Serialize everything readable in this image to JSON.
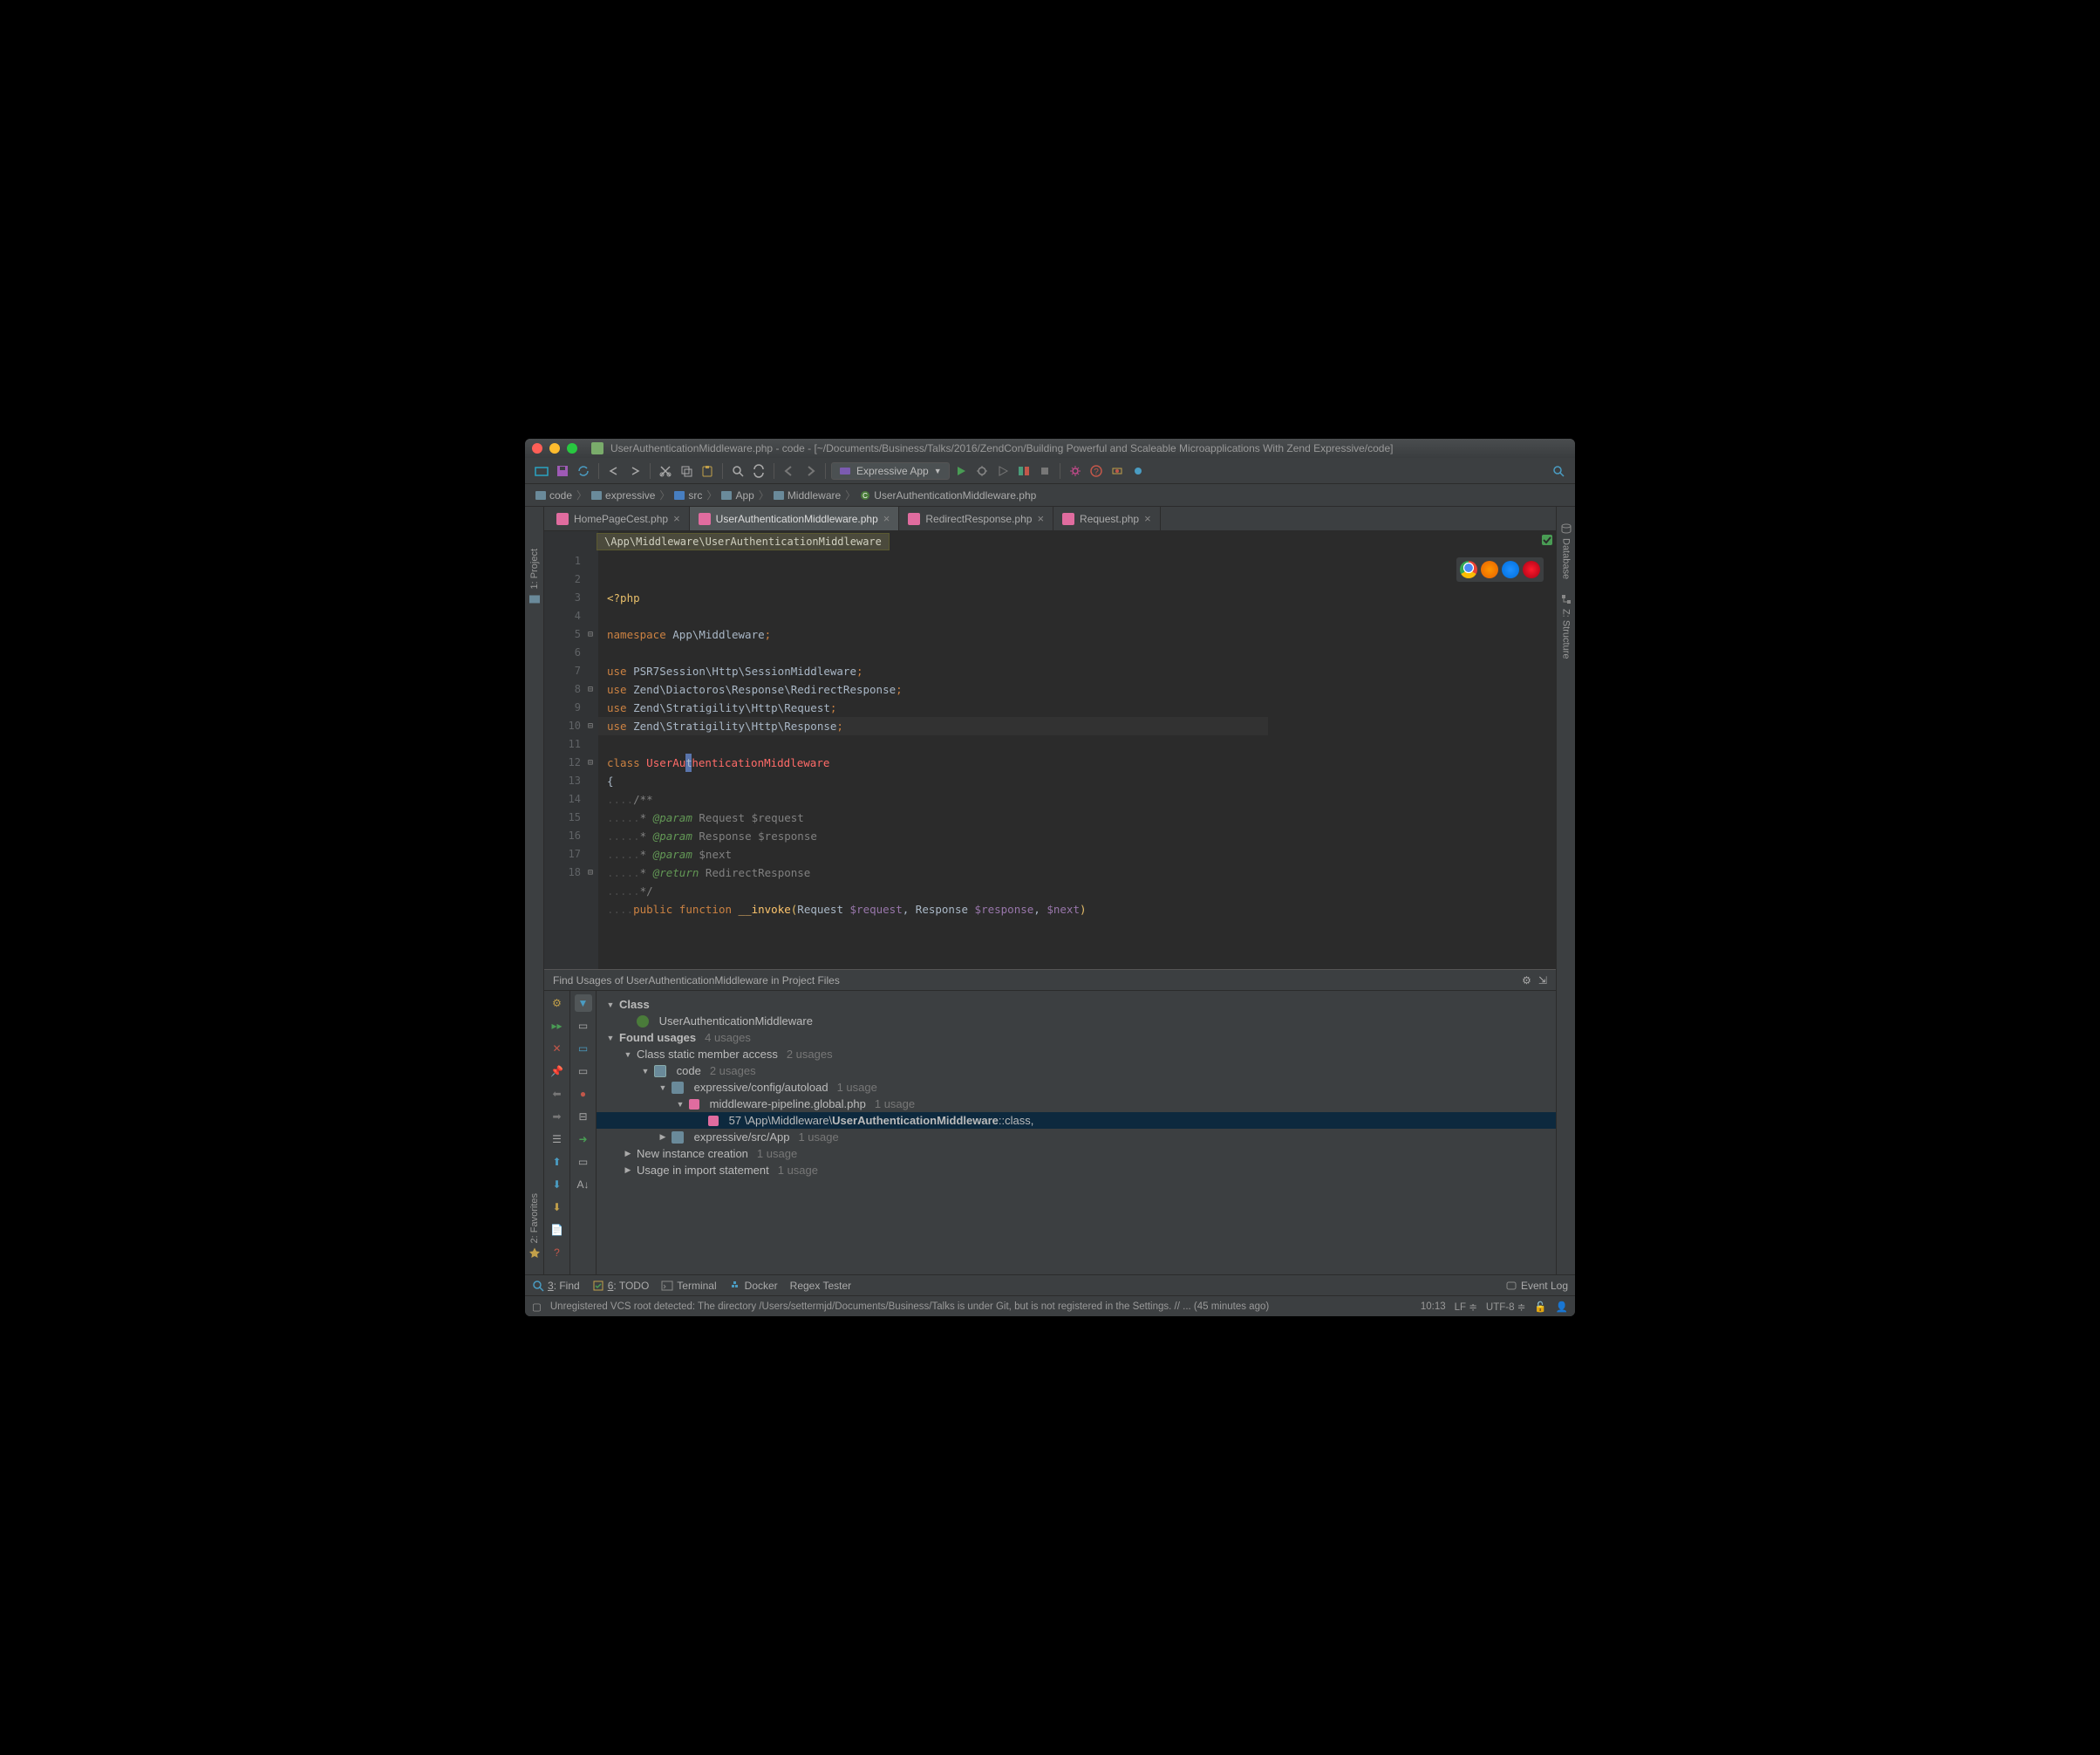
{
  "title": "UserAuthenticationMiddleware.php - code - [~/Documents/Business/Talks/2016/ZendCon/Building Powerful and Scaleable Microapplications With Zend Expressive/code]",
  "run_config": "Expressive App",
  "breadcrumbs": [
    "code",
    "expressive",
    "src",
    "App",
    "Middleware",
    "UserAuthenticationMiddleware.php"
  ],
  "tabs": [
    {
      "label": "HomePageCest.php",
      "active": false
    },
    {
      "label": "UserAuthenticationMiddleware.php",
      "active": true
    },
    {
      "label": "RedirectResponse.php",
      "active": false
    },
    {
      "label": "Request.php",
      "active": false
    }
  ],
  "namespace_banner": "\\App\\Middleware\\UserAuthenticationMiddleware",
  "left_tools": [
    "1: Project",
    "2: Favorites"
  ],
  "right_tools": [
    "Database",
    "Z: Structure"
  ],
  "code": {
    "lines": [
      "1",
      "2",
      "3",
      "4",
      "5",
      "6",
      "7",
      "8",
      "9",
      "10",
      "11",
      "12",
      "13",
      "14",
      "15",
      "16",
      "17",
      "18"
    ],
    "l1": "<?php",
    "l3_kw": "namespace",
    "l3_ns": "App\\Middleware",
    "l5_kw": "use",
    "l5_ns": "PSR7Session\\Http\\SessionMiddleware",
    "l6_kw": "use",
    "l6_ns": "Zend\\Diactoros\\Response\\RedirectResponse",
    "l7_kw": "use",
    "l7_ns": "Zend\\Stratigility\\Http\\Request",
    "l8_kw": "use",
    "l8_ns": "Zend\\Stratigility\\Http\\Response",
    "l10_kw": "class",
    "l10_a": "UserAu",
    "l10_b": "t",
    "l10_c": "henticationMiddleware",
    "l11": "{",
    "l12": "/**",
    "l13_tag": "@param",
    "l13_type": "Request",
    "l13_var": "$request",
    "l14_tag": "@param",
    "l14_type": "Response",
    "l14_var": "$response",
    "l15_tag": "@param",
    "l15_var": "$next",
    "l16_tag": "@return",
    "l16_type": "RedirectResponse",
    "l17": "*/",
    "l18_pub": "public",
    "l18_fn": "function",
    "l18_name": "__invoke",
    "l18_p1t": "Request",
    "l18_p1v": "$request",
    "l18_p2t": "Response",
    "l18_p2v": "$response",
    "l18_p3v": "$next"
  },
  "find": {
    "header": "Find Usages of UserAuthenticationMiddleware in Project Files",
    "node_class": "Class",
    "node_class_name": "UserAuthenticationMiddleware",
    "node_found": "Found usages",
    "node_found_count": "4 usages",
    "node_static": "Class static member access",
    "node_static_count": "2 usages",
    "node_code": "code",
    "node_code_count": "2 usages",
    "node_autoload": "expressive/config/autoload",
    "node_autoload_count": "1 usage",
    "node_file": "middleware-pipeline.global.php",
    "node_file_count": "1 usage",
    "node_line_num": "57",
    "node_line_pre": "\\App\\Middleware\\",
    "node_line_name": "UserAuthenticationMiddleware",
    "node_line_post": "::class,",
    "node_srcapp": "expressive/src/App",
    "node_srcapp_count": "1 usage",
    "node_new": "New instance creation",
    "node_new_count": "1 usage",
    "node_import": "Usage in import statement",
    "node_import_count": "1 usage"
  },
  "bottom_tools": {
    "find": "3: Find",
    "todo": "6: TODO",
    "terminal": "Terminal",
    "docker": "Docker",
    "regex": "Regex Tester",
    "eventlog": "Event Log"
  },
  "status": {
    "msg": "Unregistered VCS root detected: The directory /Users/settermjd/Documents/Business/Talks is under Git, but is not registered in the Settings. // ... (45 minutes ago)",
    "pos": "10:13",
    "le": "LF",
    "enc": "UTF-8"
  }
}
